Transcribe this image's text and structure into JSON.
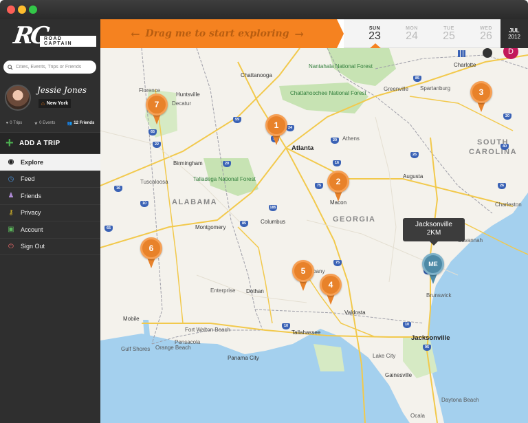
{
  "app": {
    "logo_mark": "RC",
    "logo_text": "ROAD CAPTAIN"
  },
  "search": {
    "placeholder": "Cities, Events, Trips or Friends"
  },
  "profile": {
    "name": "Jessie Jones",
    "city": "New York",
    "trips": "0 Trips",
    "events": "0 Events",
    "friends": "12 Friends"
  },
  "add_trip": "ADD A TRIP",
  "nav": [
    {
      "label": "Explore",
      "icon": "eye-icon",
      "active": true
    },
    {
      "label": "Feed",
      "icon": "clock-icon"
    },
    {
      "label": "Friends",
      "icon": "people-icon"
    },
    {
      "label": "Privacy",
      "icon": "key-icon"
    },
    {
      "label": "Account",
      "icon": "id-card-icon"
    },
    {
      "label": "Sign Out",
      "icon": "power-icon"
    }
  ],
  "dragbar": {
    "text": "Drag me to start exploring"
  },
  "dates": [
    {
      "dow": "SUN",
      "num": "23",
      "active": true
    },
    {
      "dow": "MON",
      "num": "24"
    },
    {
      "dow": "TUE",
      "num": "25"
    },
    {
      "dow": "WED",
      "num": "26"
    }
  ],
  "month": {
    "m": "JUL",
    "y": "2012"
  },
  "user_badge": "D",
  "tooltip": {
    "city": "Jacksonville",
    "distance": "2KM"
  },
  "me_label": "ME",
  "pins": [
    "1",
    "2",
    "3",
    "4",
    "5",
    "6",
    "7"
  ],
  "colors": {
    "accent": "#f58220",
    "sidebar": "#2f2f2f",
    "water": "#a4d0ee",
    "land": "#f4f2ec"
  },
  "map": {
    "states": [
      "ALABAMA",
      "GEORGIA",
      "SOUTH CAROLINA"
    ],
    "cities_major": [
      "Atlanta",
      "Jacksonville"
    ],
    "cities": [
      "Chattanooga",
      "Charlotte",
      "Huntsville",
      "Greenville",
      "Spartanburg",
      "Florence",
      "Decatur",
      "Athens",
      "Birmingham",
      "Augusta",
      "Tuscaloosa",
      "Macon",
      "Columbus",
      "Charleston",
      "Montgomery",
      "Savannah",
      "Dothan",
      "Albany",
      "Valdosta",
      "Enterprise",
      "Brunswick",
      "Mobile",
      "Tallahassee",
      "Fort Walton Beach",
      "Panama City",
      "Lake City",
      "Gainesville",
      "Ocala",
      "Daytona Beach",
      "Gulf Shores",
      "Orange Beach",
      "Pensacola"
    ],
    "parks": [
      "Nantahala National Forest",
      "Chattahoochee National Forest",
      "Talladega National Forest"
    ],
    "shields": [
      "59",
      "65",
      "24",
      "75",
      "85",
      "20",
      "26",
      "22",
      "20",
      "185",
      "75",
      "16",
      "95",
      "10",
      "10",
      "95",
      "75",
      "10",
      "85",
      "26",
      "40",
      "65",
      "20",
      "16"
    ]
  }
}
